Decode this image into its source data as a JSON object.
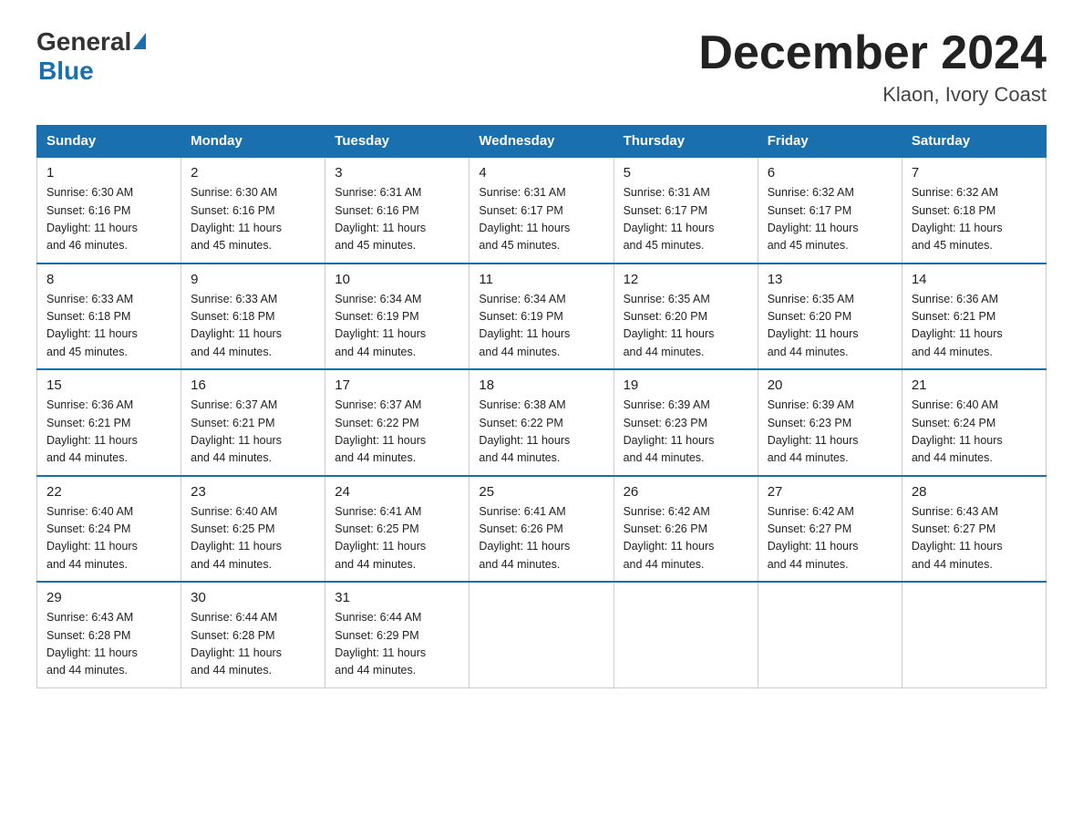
{
  "header": {
    "logo_general": "General",
    "logo_blue": "Blue",
    "month_title": "December 2024",
    "location": "Klaon, Ivory Coast"
  },
  "days_of_week": [
    "Sunday",
    "Monday",
    "Tuesday",
    "Wednesday",
    "Thursday",
    "Friday",
    "Saturday"
  ],
  "weeks": [
    [
      {
        "day": "1",
        "sunrise": "6:30 AM",
        "sunset": "6:16 PM",
        "daylight": "11 hours and 46 minutes."
      },
      {
        "day": "2",
        "sunrise": "6:30 AM",
        "sunset": "6:16 PM",
        "daylight": "11 hours and 45 minutes."
      },
      {
        "day": "3",
        "sunrise": "6:31 AM",
        "sunset": "6:16 PM",
        "daylight": "11 hours and 45 minutes."
      },
      {
        "day": "4",
        "sunrise": "6:31 AM",
        "sunset": "6:17 PM",
        "daylight": "11 hours and 45 minutes."
      },
      {
        "day": "5",
        "sunrise": "6:31 AM",
        "sunset": "6:17 PM",
        "daylight": "11 hours and 45 minutes."
      },
      {
        "day": "6",
        "sunrise": "6:32 AM",
        "sunset": "6:17 PM",
        "daylight": "11 hours and 45 minutes."
      },
      {
        "day": "7",
        "sunrise": "6:32 AM",
        "sunset": "6:18 PM",
        "daylight": "11 hours and 45 minutes."
      }
    ],
    [
      {
        "day": "8",
        "sunrise": "6:33 AM",
        "sunset": "6:18 PM",
        "daylight": "11 hours and 45 minutes."
      },
      {
        "day": "9",
        "sunrise": "6:33 AM",
        "sunset": "6:18 PM",
        "daylight": "11 hours and 44 minutes."
      },
      {
        "day": "10",
        "sunrise": "6:34 AM",
        "sunset": "6:19 PM",
        "daylight": "11 hours and 44 minutes."
      },
      {
        "day": "11",
        "sunrise": "6:34 AM",
        "sunset": "6:19 PM",
        "daylight": "11 hours and 44 minutes."
      },
      {
        "day": "12",
        "sunrise": "6:35 AM",
        "sunset": "6:20 PM",
        "daylight": "11 hours and 44 minutes."
      },
      {
        "day": "13",
        "sunrise": "6:35 AM",
        "sunset": "6:20 PM",
        "daylight": "11 hours and 44 minutes."
      },
      {
        "day": "14",
        "sunrise": "6:36 AM",
        "sunset": "6:21 PM",
        "daylight": "11 hours and 44 minutes."
      }
    ],
    [
      {
        "day": "15",
        "sunrise": "6:36 AM",
        "sunset": "6:21 PM",
        "daylight": "11 hours and 44 minutes."
      },
      {
        "day": "16",
        "sunrise": "6:37 AM",
        "sunset": "6:21 PM",
        "daylight": "11 hours and 44 minutes."
      },
      {
        "day": "17",
        "sunrise": "6:37 AM",
        "sunset": "6:22 PM",
        "daylight": "11 hours and 44 minutes."
      },
      {
        "day": "18",
        "sunrise": "6:38 AM",
        "sunset": "6:22 PM",
        "daylight": "11 hours and 44 minutes."
      },
      {
        "day": "19",
        "sunrise": "6:39 AM",
        "sunset": "6:23 PM",
        "daylight": "11 hours and 44 minutes."
      },
      {
        "day": "20",
        "sunrise": "6:39 AM",
        "sunset": "6:23 PM",
        "daylight": "11 hours and 44 minutes."
      },
      {
        "day": "21",
        "sunrise": "6:40 AM",
        "sunset": "6:24 PM",
        "daylight": "11 hours and 44 minutes."
      }
    ],
    [
      {
        "day": "22",
        "sunrise": "6:40 AM",
        "sunset": "6:24 PM",
        "daylight": "11 hours and 44 minutes."
      },
      {
        "day": "23",
        "sunrise": "6:40 AM",
        "sunset": "6:25 PM",
        "daylight": "11 hours and 44 minutes."
      },
      {
        "day": "24",
        "sunrise": "6:41 AM",
        "sunset": "6:25 PM",
        "daylight": "11 hours and 44 minutes."
      },
      {
        "day": "25",
        "sunrise": "6:41 AM",
        "sunset": "6:26 PM",
        "daylight": "11 hours and 44 minutes."
      },
      {
        "day": "26",
        "sunrise": "6:42 AM",
        "sunset": "6:26 PM",
        "daylight": "11 hours and 44 minutes."
      },
      {
        "day": "27",
        "sunrise": "6:42 AM",
        "sunset": "6:27 PM",
        "daylight": "11 hours and 44 minutes."
      },
      {
        "day": "28",
        "sunrise": "6:43 AM",
        "sunset": "6:27 PM",
        "daylight": "11 hours and 44 minutes."
      }
    ],
    [
      {
        "day": "29",
        "sunrise": "6:43 AM",
        "sunset": "6:28 PM",
        "daylight": "11 hours and 44 minutes."
      },
      {
        "day": "30",
        "sunrise": "6:44 AM",
        "sunset": "6:28 PM",
        "daylight": "11 hours and 44 minutes."
      },
      {
        "day": "31",
        "sunrise": "6:44 AM",
        "sunset": "6:29 PM",
        "daylight": "11 hours and 44 minutes."
      },
      null,
      null,
      null,
      null
    ]
  ],
  "labels": {
    "sunrise": "Sunrise:",
    "sunset": "Sunset:",
    "daylight": "Daylight:"
  }
}
